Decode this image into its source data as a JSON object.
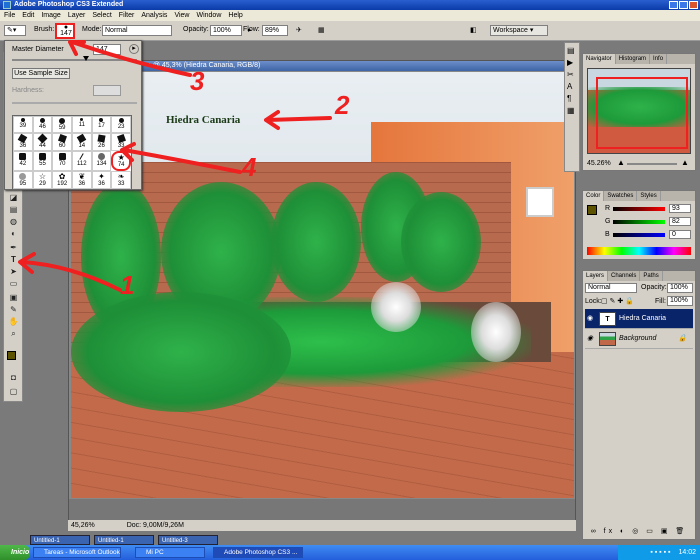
{
  "app": {
    "title": "Adobe Photoshop CS3 Extended"
  },
  "menu": [
    "File",
    "Edit",
    "Image",
    "Layer",
    "Select",
    "Filter",
    "Analysis",
    "View",
    "Window",
    "Help"
  ],
  "options": {
    "brush_label": "Brush:",
    "brush_size": "147",
    "mode_label": "Mode:",
    "mode_value": "Normal",
    "opacity_label": "Opacity:",
    "opacity_value": "100%",
    "flow_label": "Flow:",
    "flow_value": "89%",
    "workspace_label": "Workspace ▾"
  },
  "brush_panel": {
    "master_diameter_label": "Master Diameter",
    "master_diameter_value": "147",
    "sample_size_button": "Use Sample Size",
    "hardness_label": "Hardness:",
    "cells": [
      "39",
      "46",
      "59",
      "11",
      "17",
      "23",
      "36",
      "44",
      "60",
      "14",
      "26",
      "33",
      "42",
      "55",
      "70",
      "112",
      "134",
      "74",
      "95",
      "29",
      "192",
      "36",
      "36",
      "33"
    ]
  },
  "document": {
    "title": "o @ 45,3% (Hiedra Canaria, RGB/8)",
    "layer_text": "Hiedra Canaria",
    "zoom": "45,26%",
    "doc_info": "Doc: 9,00M/9,26M"
  },
  "navigator": {
    "tabs": [
      "Navigator",
      "Histogram",
      "Info"
    ],
    "zoom": "45.26%"
  },
  "color_panel": {
    "tabs": [
      "Color",
      "Swatches",
      "Styles"
    ],
    "r_label": "R",
    "r_value": "93",
    "g_label": "G",
    "g_value": "82",
    "b_label": "B",
    "b_value": "0"
  },
  "layers_panel": {
    "tabs": [
      "Layers",
      "Channels",
      "Paths"
    ],
    "blend_mode": "Normal",
    "opacity_label": "Opacity:",
    "opacity_value": "100%",
    "lock_label": "Lock:",
    "fill_label": "Fill:",
    "fill_value": "100%",
    "layers": [
      {
        "name": "Hiedra Canaria",
        "thumb": "T"
      },
      {
        "name": "Background",
        "thumb": ""
      }
    ]
  },
  "minimized": [
    "Untitled-1",
    "Untitled-1",
    "Untitled-3"
  ],
  "taskbar": {
    "start": "Inicio",
    "tasks": [
      "Tareas - Microsoft Outlook",
      "Mi PC",
      "Adobe Photoshop CS3 ..."
    ],
    "clock": "14:02"
  },
  "annotations": [
    "1",
    "2",
    "3",
    "4"
  ],
  "colors": {
    "annotation": "#ef2020",
    "selected_layer": "#0a246a"
  }
}
